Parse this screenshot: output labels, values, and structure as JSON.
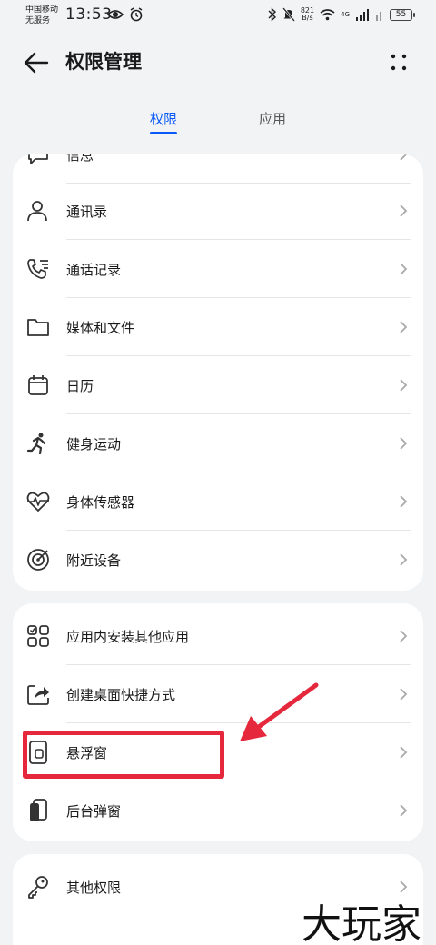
{
  "status_bar": {
    "carrier_line1": "中国移动",
    "carrier_line2": "无服务",
    "time": "13:53",
    "net_speed_value": "821",
    "net_speed_unit": "B/s",
    "network_type": "4G",
    "battery": "55"
  },
  "header": {
    "title": "权限管理"
  },
  "tabs": [
    {
      "label": "权限",
      "active": true
    },
    {
      "label": "应用",
      "active": false
    }
  ],
  "permissions_group1": [
    {
      "label": "信息",
      "icon": "message-icon"
    },
    {
      "label": "通讯录",
      "icon": "contacts-icon"
    },
    {
      "label": "通话记录",
      "icon": "call-log-icon"
    },
    {
      "label": "媒体和文件",
      "icon": "folder-icon"
    },
    {
      "label": "日历",
      "icon": "calendar-icon"
    },
    {
      "label": "健身运动",
      "icon": "running-icon"
    },
    {
      "label": "身体传感器",
      "icon": "heart-rate-icon"
    },
    {
      "label": "附近设备",
      "icon": "nearby-devices-icon"
    }
  ],
  "permissions_group2": [
    {
      "label": "应用内安装其他应用",
      "icon": "apps-grid-icon"
    },
    {
      "label": "创建桌面快捷方式",
      "icon": "shortcut-icon"
    },
    {
      "label": "悬浮窗",
      "icon": "floating-window-icon"
    },
    {
      "label": "后台弹窗",
      "icon": "background-popup-icon"
    }
  ],
  "permissions_group3": [
    {
      "label": "其他权限",
      "icon": "key-icon"
    }
  ],
  "watermark": "大玩家",
  "colors": {
    "accent": "#0a59f7",
    "highlight": "#e5283b",
    "background": "#f1f3f5"
  }
}
